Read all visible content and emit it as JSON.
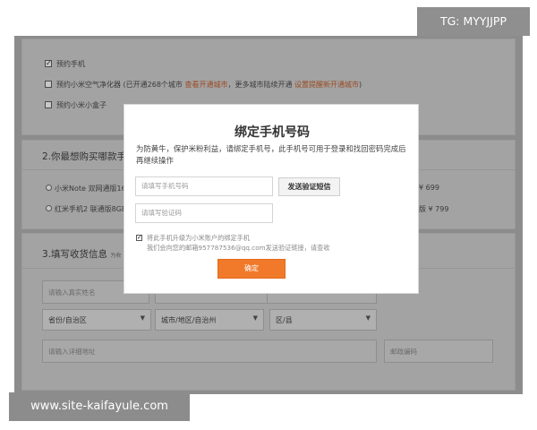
{
  "watermark_top": "TG: MYYJJPP",
  "watermark_bottom": "www.site-kaifayule.com",
  "section1": {
    "opt1": "预约手机",
    "opt2_prefix": "预约小米空气净化器 (已开通268个城市 ",
    "opt2_link1": "查看开通城市",
    "opt2_mid": "，更多城市陆续开通 ",
    "opt2_link2": "设置提醒新开通城市",
    "opt2_suffix": ")",
    "opt3": "预约小米小盒子"
  },
  "section2": {
    "title": "2.你最想购买哪款手",
    "opt1_left": "小米Note 双网通版16",
    "opt1_right": "¥ 699",
    "opt2_left": "红米手机2 联通版8GE",
    "opt2_right": "版 ¥ 799"
  },
  "section3": {
    "title": "3.填写收货信息",
    "title_note": "为收",
    "name_placeholder": "请输入真实姓名",
    "province": "省份/自治区",
    "city": "城市/地区/自治州",
    "district": "区/县",
    "address_placeholder": "请输入详细地址",
    "zip_placeholder": "邮政编码"
  },
  "modal": {
    "title": "绑定手机号码",
    "description": "为防黄牛，保护米粉利益，请绑定手机号，此手机号可用于登录和找回密码完成后再继续操作",
    "phone_placeholder": "请填写手机号码",
    "send_code_label": "发送验证短信",
    "code_placeholder": "请填写验证码",
    "upgrade_label": "将此手机升级为小米账户的绑定手机",
    "email_note": "我们会向您的邮箱957787536@qq.com发送验证链接，请查收",
    "confirm_label": "确定"
  },
  "colors": {
    "accent": "#f07a2a",
    "overlay": "#8c8c8c",
    "link": "#9a4a22"
  }
}
